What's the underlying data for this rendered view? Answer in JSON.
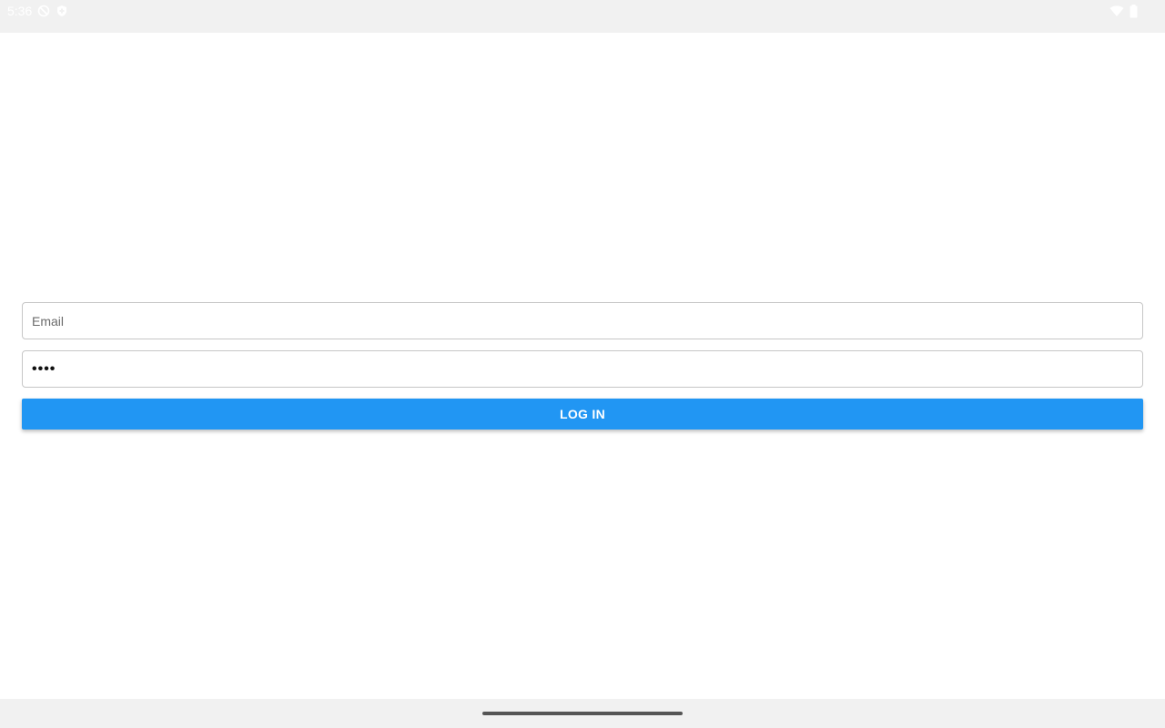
{
  "status_bar": {
    "time": "5:36",
    "icons": [
      "do-not-disturb-icon",
      "shield-icon",
      "wifi-icon",
      "battery-icon"
    ]
  },
  "login_form": {
    "email": {
      "value": "",
      "placeholder": "Email"
    },
    "password": {
      "value": "••••",
      "placeholder": ""
    },
    "login_button_label": "LOG IN"
  },
  "colors": {
    "accent": "#2196f3",
    "status_bar_bg": "#f1f1f1",
    "nav_bar_bg": "#f1f1f1",
    "field_border": "#c6c6c6"
  },
  "nav_bar": {
    "handle": "home-gesture-handle"
  }
}
